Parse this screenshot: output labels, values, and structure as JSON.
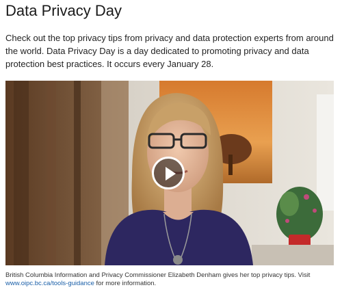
{
  "page": {
    "title": "Data Privacy Day",
    "intro": "Check out the top privacy tips from privacy and data protection experts from around the world. Data Privacy Day is a day dedicated to promoting privacy and data protection best practices. It occurs every January 28."
  },
  "video": {
    "play_icon": "play-icon"
  },
  "caption": {
    "text_before": "British Columbia Information and Privacy Commissioner Elizabeth Denham gives her top privacy tips. Visit ",
    "link_text": "www.oipc.bc.ca/tools-guidance",
    "text_after": " for more information."
  },
  "colors": {
    "link": "#1a5fa8",
    "title": "#1a1a1a"
  }
}
